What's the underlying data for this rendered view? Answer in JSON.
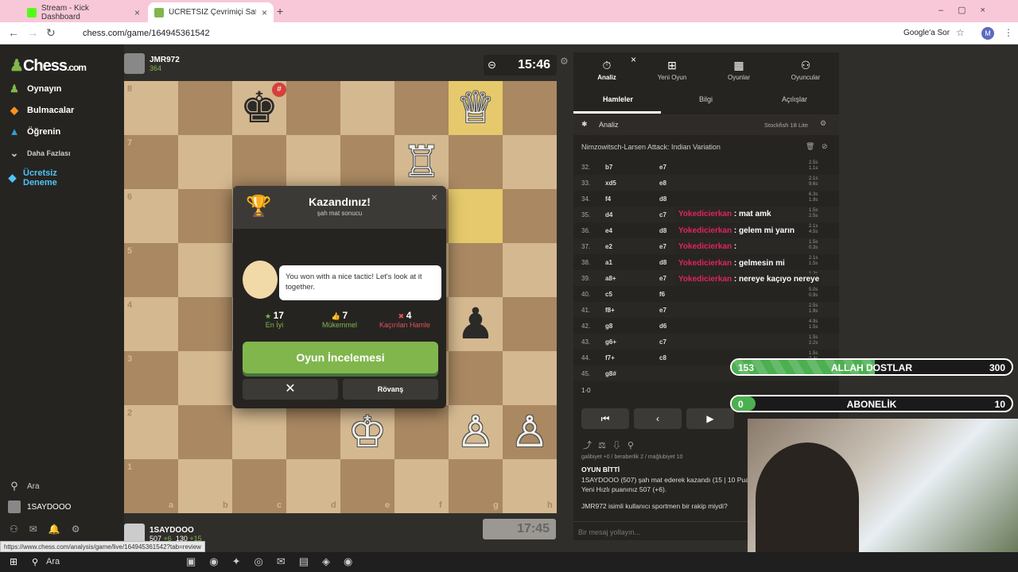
{
  "browser": {
    "tabs": [
      {
        "title": "Stream - Kick Dashboard"
      },
      {
        "title": "ÜCRETSİZ Çevrimiçi Satranç Oy"
      }
    ],
    "url": "chess.com/game/164945361542",
    "google_label": "Google'a Sor",
    "profile_initial": "M",
    "status_url": "https://www.chess.com/analysis/game/live/164945361542?tab=review"
  },
  "sidebar": {
    "logo": "Chess",
    "logo_suffix": ".com",
    "items": [
      {
        "label": "Oynayın",
        "icon": "pawn-icon"
      },
      {
        "label": "Bulmacalar",
        "icon": "puzzle-icon"
      },
      {
        "label": "Öğrenin",
        "icon": "learn-icon"
      },
      {
        "label": "Daha Fazlası",
        "icon": "chevron-down-icon"
      },
      {
        "label": "Ücretsiz Deneme",
        "icon": "diamond-icon"
      }
    ],
    "search": "Ara",
    "user": "1SAYDOOO"
  },
  "top_player": {
    "name": "JMR972",
    "rating": "364",
    "clock": "15:46"
  },
  "bottom_player": {
    "name": "1SAYDOOO",
    "rating": "507",
    "delta": "+6",
    "extra": "130",
    "extra_delta": "+15",
    "clock": "17:45"
  },
  "board": {
    "ranks": [
      "8",
      "7",
      "6",
      "5",
      "4",
      "3",
      "2",
      "1"
    ],
    "files": [
      "a",
      "b",
      "c",
      "d",
      "e",
      "f",
      "g",
      "h"
    ]
  },
  "modal": {
    "title": "Kazandınız!",
    "subtitle": "şah mat sonucu",
    "coach_text": "You won with a nice tactic! Let's look at it together.",
    "stats": [
      {
        "count": "17",
        "label": "En İyi",
        "color": "#81b64c"
      },
      {
        "count": "7",
        "label": "Mükemmel",
        "color": "#81b64c"
      },
      {
        "count": "4",
        "label": "Kaçırılan Hamle",
        "color": "#e0525e"
      }
    ],
    "review_button": "Oyun İncelemesi",
    "rematch_button": "Rövanş"
  },
  "right_panel": {
    "top_tabs": [
      "Analiz",
      "Yeni Oyun",
      "Oyunlar",
      "Oyuncular"
    ],
    "sub_tabs": [
      "Hamleler",
      "Bilgi",
      "Açılışlar"
    ],
    "analysis_label": "Analiz",
    "engine": "Stockfish 18 Lite",
    "opening": "Nimzowitsch-Larsen Attack: Indian Variation",
    "moves": [
      {
        "num": "32.",
        "w": "b7",
        "b": "e7",
        "t1": "2.5s",
        "t2": "1.1s"
      },
      {
        "num": "33.",
        "w": "xd5",
        "b": "e8",
        "t1": "2.1s",
        "t2": "9.6s"
      },
      {
        "num": "34.",
        "w": "f4",
        "b": "d8",
        "t1": "6.3s",
        "t2": "1.9s"
      },
      {
        "num": "35.",
        "w": "d4",
        "b": "c7",
        "t1": "1.5s",
        "t2": "2.5s"
      },
      {
        "num": "36.",
        "w": "e4",
        "b": "d8",
        "t1": "2.1s",
        "t2": "4.5s"
      },
      {
        "num": "37.",
        "w": "e2",
        "b": "e7",
        "t1": "1.5s",
        "t2": "0.3s"
      },
      {
        "num": "38.",
        "w": "a1",
        "b": "d8",
        "t1": "2.1s",
        "t2": "1.5s"
      },
      {
        "num": "39.",
        "w": "a8+",
        "b": "e7",
        "t1": "1.2s",
        "t2": "1.5s"
      },
      {
        "num": "40.",
        "w": "c5",
        "b": "f6",
        "t1": "5.0s",
        "t2": "0.9s"
      },
      {
        "num": "41.",
        "w": "f8+",
        "b": "e7",
        "t1": "2.5s",
        "t2": "1.9s"
      },
      {
        "num": "42.",
        "w": "g8",
        "b": "d6",
        "t1": "4.9s",
        "t2": "1.5s"
      },
      {
        "num": "43.",
        "w": "g6+",
        "b": "c7",
        "t1": "1.5s",
        "t2": "2.2s"
      },
      {
        "num": "44.",
        "w": "f7+",
        "b": "c8",
        "t1": "1.5s",
        "t2": "2.4s"
      },
      {
        "num": "45.",
        "w": "g8#",
        "b": "",
        "t1": "",
        "t2": ""
      }
    ],
    "result": "1-0",
    "game_over_title": "OYUN BİTTİ",
    "game_over_line1": "1SAYDOOO (507) şah mat ederek kazandı (15 | 10 Pua",
    "game_over_line2": "Yeni Hızlı puanınız 507 (+6).",
    "summary_partial": "galibiyet +0 / beraberlik 2 / mağlubiyet 10",
    "chat_question": "JMR972 isimli kullanıcı sportmen bir rakip miydi?",
    "message_placeholder": "Bir mesaj yollayın..."
  },
  "stream_chat": [
    {
      "user": "Yokedicierkan",
      "msg": " : mat amk"
    },
    {
      "user": "Yokedicierkan",
      "msg": " : gelem mi yarın"
    },
    {
      "user": "Yokedicierkan",
      "msg": " :"
    },
    {
      "user": "Yokedicierkan",
      "msg": " : gelmesin mi"
    },
    {
      "user": "Yokedicierkan",
      "msg": " : nereye kaçıyo nereye"
    }
  ],
  "goals": [
    {
      "left": "153",
      "label": "ALLAH DOSTLAR",
      "right": "300",
      "fill": 0.51
    },
    {
      "left": "0",
      "label": "ABONELİK",
      "right": "10",
      "fill": 0.0
    }
  ],
  "taskbar": {
    "search": "Ara"
  }
}
